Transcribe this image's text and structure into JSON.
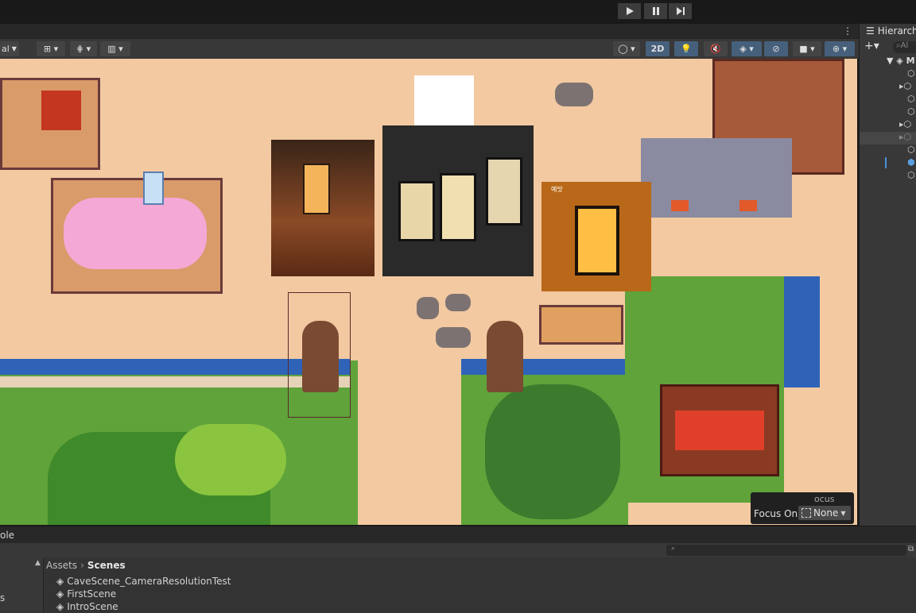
{
  "playbar": {
    "play_icon": "play-icon",
    "pause_icon": "pause-icon",
    "step_icon": "step-icon"
  },
  "toolbar": {
    "left_dropdown": "al",
    "mode_2d": "2D",
    "focus_label": "Focus On",
    "focus_value": "None",
    "focus_overlay_text": "ocus"
  },
  "hierarchy": {
    "title": "Hierarch",
    "search_placeholder": "Al",
    "root_label": "M"
  },
  "scene_images": {
    "lantern3_label": "예맛"
  },
  "bottom": {
    "tab_fragment": "ole"
  },
  "project": {
    "breadcrumb_root": "Assets",
    "breadcrumb_current": "Scenes",
    "left_fragment": "s",
    "files": [
      "CaveScene_CameraResolutionTest",
      "FirstScene",
      "IntroScene"
    ]
  },
  "colors": {
    "accent": "#46607c",
    "ground": "#f2c9a1",
    "grass": "#5fa33a",
    "water": "#2f63b8"
  }
}
